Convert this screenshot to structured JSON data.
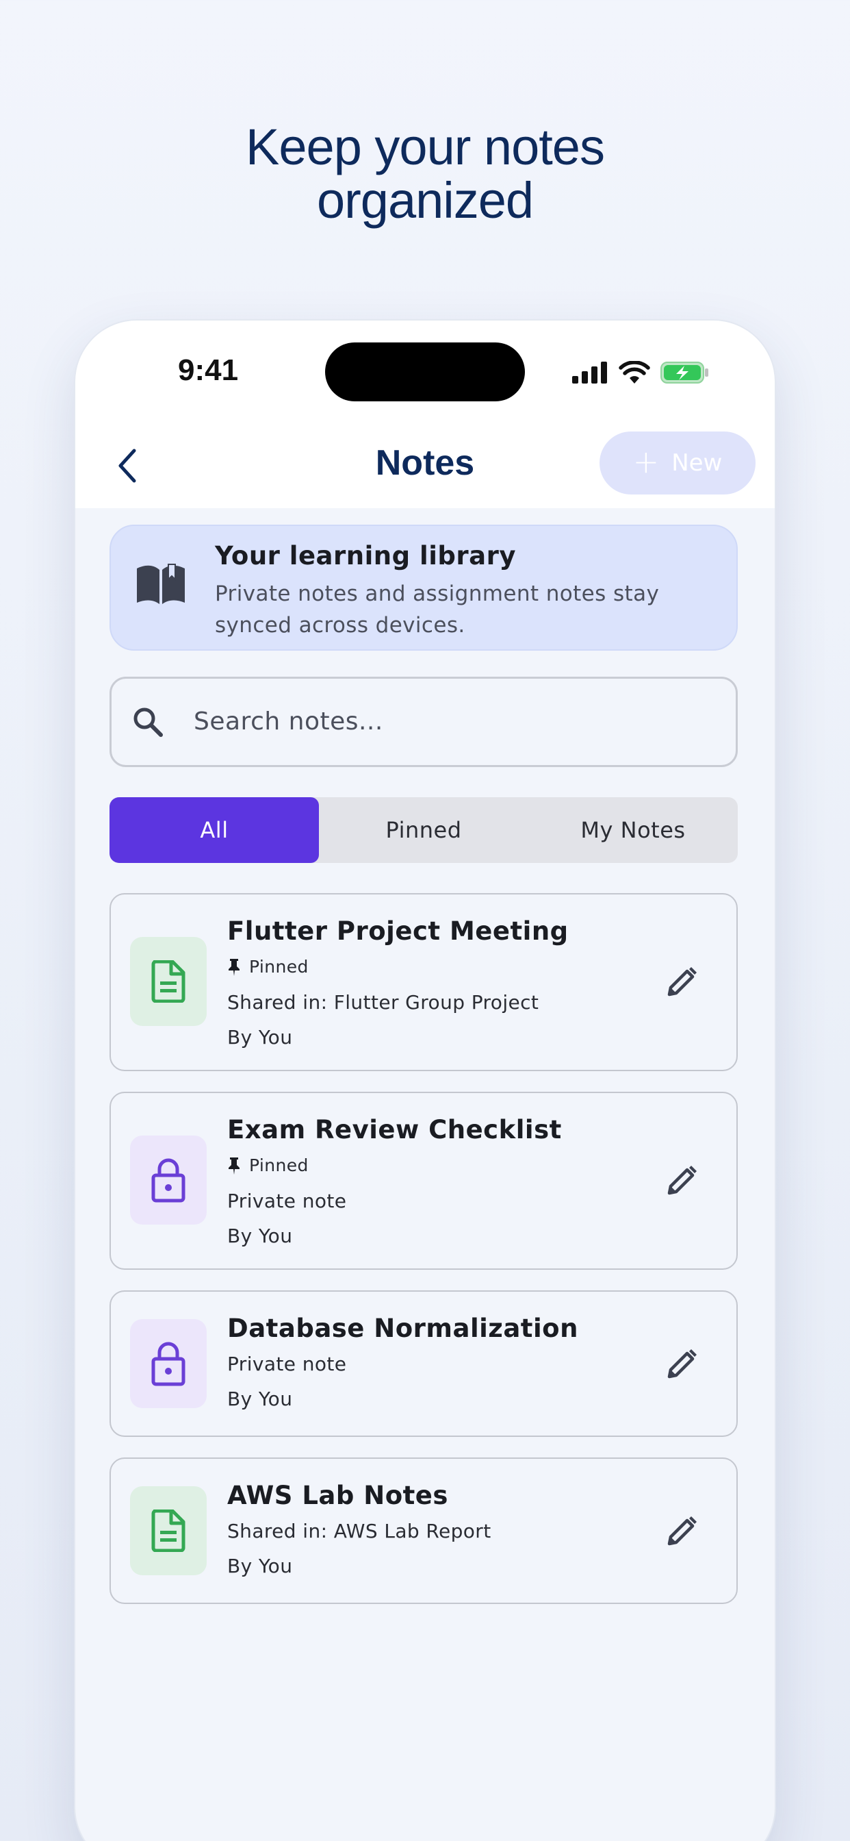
{
  "headline": {
    "line1": "Keep your notes",
    "line2": "organized"
  },
  "status_bar": {
    "time": "9:41"
  },
  "nav": {
    "title": "Notes",
    "new_label": "New"
  },
  "banner": {
    "title": "Your learning library",
    "text": "Private notes and assignment notes stay synced across devices."
  },
  "search": {
    "placeholder": "Search notes..."
  },
  "tabs": [
    {
      "label": "All",
      "active": true
    },
    {
      "label": "Pinned",
      "active": false
    },
    {
      "label": "My Notes",
      "active": false
    }
  ],
  "notes": [
    {
      "title": "Flutter Project Meeting",
      "pinned_label": "Pinned",
      "detail": "Shared in: Flutter Group Project",
      "author": "By You",
      "icon": "document-icon"
    },
    {
      "title": "Exam Review Checklist",
      "pinned_label": "Pinned",
      "detail": "Private note",
      "author": "By You",
      "icon": "lock-icon"
    },
    {
      "title": "Database Normalization",
      "detail": "Private note",
      "author": "By You",
      "icon": "lock-icon"
    },
    {
      "title": "AWS Lab Notes",
      "detail": "Shared in: AWS Lab Report",
      "author": "By You",
      "icon": "document-icon"
    }
  ],
  "colors": {
    "accent": "#5c35e0",
    "headline": "#0e2a5c",
    "doc_green": "#34a853",
    "lock_purple": "#6a3fd6"
  }
}
